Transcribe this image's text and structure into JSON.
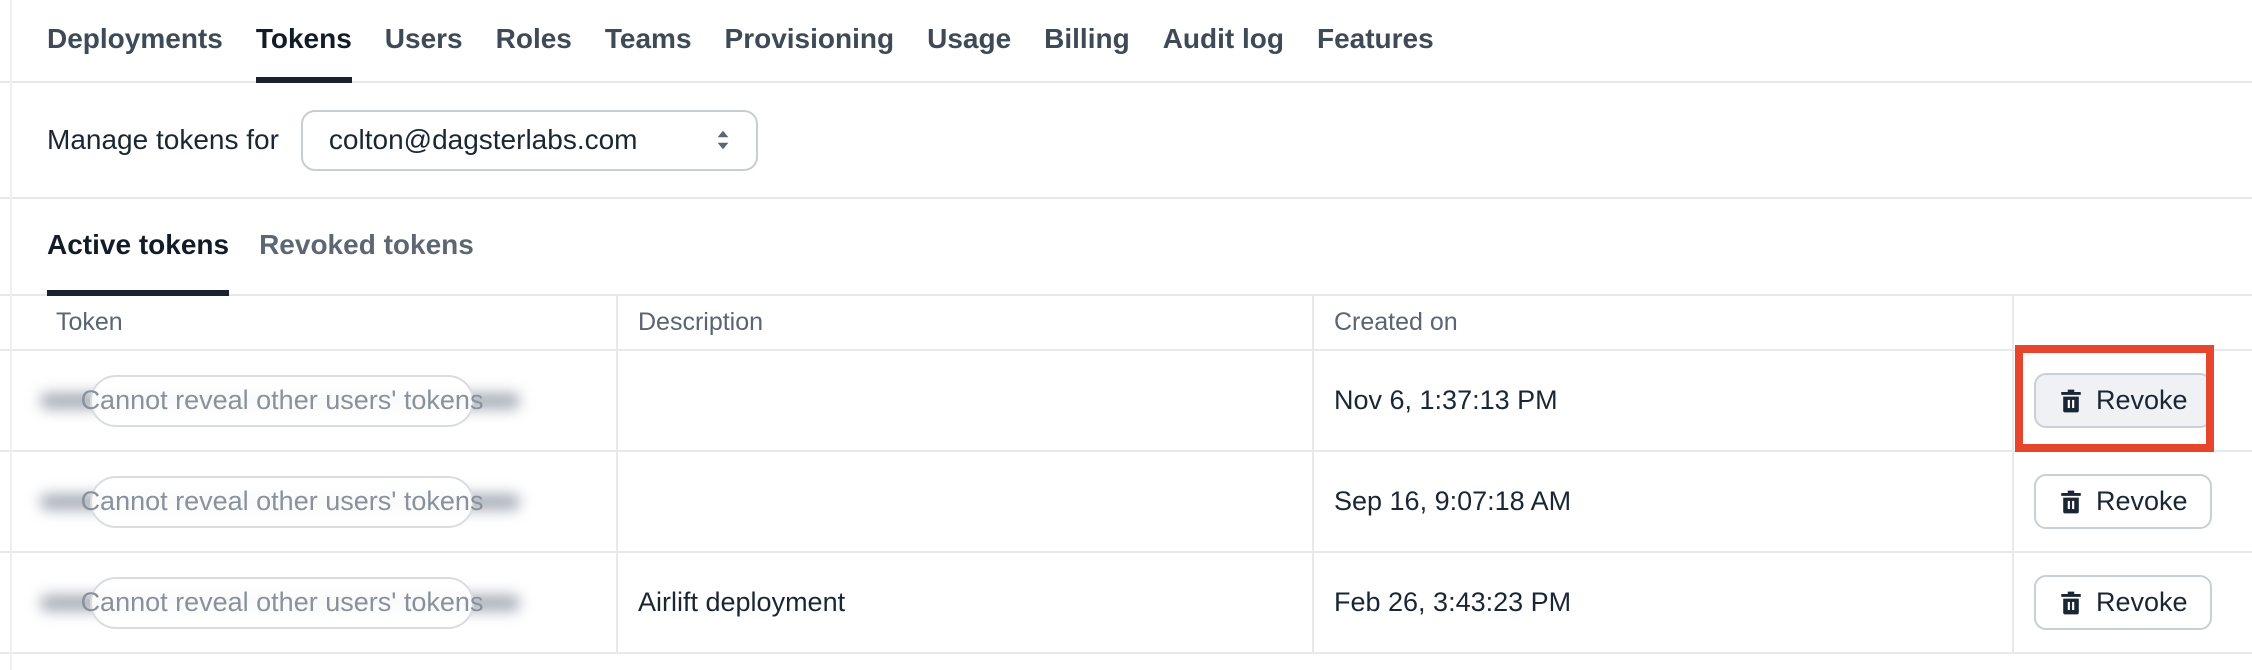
{
  "colors": {
    "annotation_highlight": "#e8462c",
    "active_tab_underline": "#1a2230",
    "text_primary": "#1b2634",
    "text_muted": "#5a6472",
    "pill_text": "#8a919d",
    "border": "#e7e9ec"
  },
  "tabs": {
    "items": [
      {
        "label": "Deployments",
        "active": false
      },
      {
        "label": "Tokens",
        "active": true
      },
      {
        "label": "Users",
        "active": false
      },
      {
        "label": "Roles",
        "active": false
      },
      {
        "label": "Teams",
        "active": false
      },
      {
        "label": "Provisioning",
        "active": false
      },
      {
        "label": "Usage",
        "active": false
      },
      {
        "label": "Billing",
        "active": false
      },
      {
        "label": "Audit log",
        "active": false
      },
      {
        "label": "Features",
        "active": false
      }
    ]
  },
  "manage": {
    "label": "Manage tokens for",
    "selected_user": "colton@dagsterlabs.com"
  },
  "subtabs": {
    "items": [
      {
        "label": "Active tokens",
        "active": true
      },
      {
        "label": "Revoked tokens",
        "active": false
      }
    ]
  },
  "table": {
    "columns": {
      "token": "Token",
      "description": "Description",
      "created_on": "Created on",
      "actions": ""
    },
    "rows": [
      {
        "token_placeholder": "Cannot reveal other users' tokens",
        "description": "",
        "created_on": "Nov 6, 1:37:13 PM",
        "action": "Revoke",
        "annotated": true
      },
      {
        "token_placeholder": "Cannot reveal other users' tokens",
        "description": "",
        "created_on": "Sep 16, 9:07:18 AM",
        "action": "Revoke",
        "annotated": false
      },
      {
        "token_placeholder": "Cannot reveal other users' tokens",
        "description": "Airlift deployment",
        "created_on": "Feb 26, 3:43:23 PM",
        "action": "Revoke",
        "annotated": false
      }
    ]
  }
}
